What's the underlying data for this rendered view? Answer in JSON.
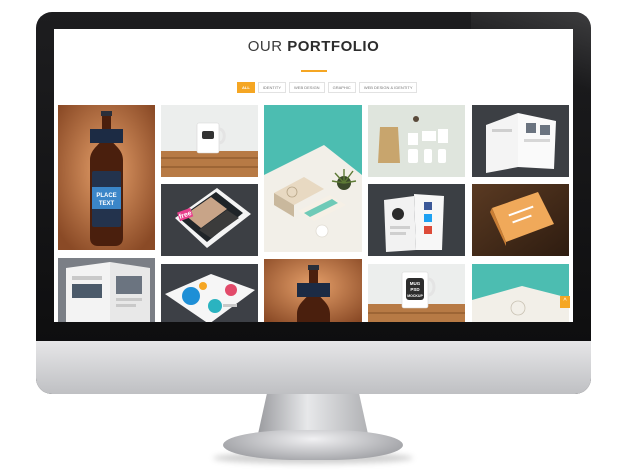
{
  "portfolio": {
    "title_light": "OUR",
    "title_strong": "PORTFOLIO",
    "accent_color": "#f5a623"
  },
  "filters": [
    {
      "label": "ALL",
      "active": true
    },
    {
      "label": "IDENTITY",
      "active": false
    },
    {
      "label": "WEB DESIGN",
      "active": false
    },
    {
      "label": "GRAPHIC",
      "active": false
    },
    {
      "label": "WEB DESIGN & IDENTITY",
      "active": false
    }
  ],
  "mockups": {
    "bottle_line1": "PLACE",
    "bottle_line2": "TEXT",
    "mug_line1": "MUG",
    "mug_line2": "PSD",
    "mug_line3": "MOCKUP",
    "magazine_badge": "free"
  },
  "scroll_top_icon": "chevron-up-icon"
}
